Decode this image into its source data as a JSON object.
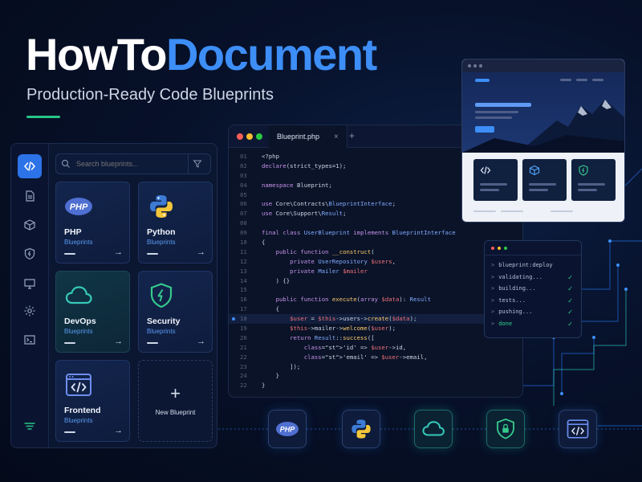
{
  "brand": {
    "word_white": "HowTo",
    "word_blue": "Document",
    "tagline": "Production-Ready Code Blueprints"
  },
  "colors": {
    "accent": "#3d8ef7",
    "green": "#27c488",
    "teal": "#2fc2b0",
    "background": "#07112a"
  },
  "sidebar": {
    "rail_icons": [
      "code-icon",
      "document-icon",
      "cube-icon",
      "shield-bolt-icon",
      "monitor-icon",
      "gear-icon",
      "terminal-icon",
      "filter-lines-icon"
    ],
    "search": {
      "placeholder": "Search blueprints..."
    },
    "cards": [
      {
        "name": "PHP",
        "subtitle": "Blueprints",
        "icon": "php-logo-icon"
      },
      {
        "name": "Python",
        "subtitle": "Blueprints",
        "icon": "python-logo-icon"
      },
      {
        "name": "DevOps",
        "subtitle": "Blueprints",
        "icon": "cloud-icon"
      },
      {
        "name": "Security",
        "subtitle": "Blueprints",
        "icon": "shield-bolt-icon"
      },
      {
        "name": "Frontend",
        "subtitle": "Blueprints",
        "icon": "browser-code-icon"
      }
    ],
    "new_card": {
      "label": "New Blueprint",
      "plus": "+"
    }
  },
  "editor": {
    "tab": "Blueprint.php",
    "tab_close": "×",
    "add_tab": "+",
    "active_line": "18",
    "lines": [
      {
        "n": "01",
        "code": "<?php"
      },
      {
        "n": "02",
        "code": "declare(strict_types=1);"
      },
      {
        "n": "03",
        "code": ""
      },
      {
        "n": "04",
        "code": "namespace Blueprint;"
      },
      {
        "n": "05",
        "code": ""
      },
      {
        "n": "06",
        "code": "use Core\\Contracts\\BlueprintInterface;"
      },
      {
        "n": "07",
        "code": "use Core\\Support\\Result;"
      },
      {
        "n": "08",
        "code": ""
      },
      {
        "n": "09",
        "code": "final class UserBlueprint implements BlueprintInterface"
      },
      {
        "n": "10",
        "code": "{"
      },
      {
        "n": "11",
        "code": "    public function __construct("
      },
      {
        "n": "12",
        "code": "        private UserRepository $users,"
      },
      {
        "n": "13",
        "code": "        private Mailer $mailer"
      },
      {
        "n": "14",
        "code": "    ) {}"
      },
      {
        "n": "15",
        "code": ""
      },
      {
        "n": "16",
        "code": "    public function execute(array $data): Result"
      },
      {
        "n": "17",
        "code": "    {"
      },
      {
        "n": "18",
        "code": "        $user = $this->users->create($data);"
      },
      {
        "n": "19",
        "code": "        $this->mailer->welcome($user);"
      },
      {
        "n": "20",
        "code": "        return Result::success(["
      },
      {
        "n": "21",
        "code": "            'id' => $user->id,"
      },
      {
        "n": "22",
        "code": "            'email' => $user->email,"
      },
      {
        "n": "23",
        "code": "        ]);"
      },
      {
        "n": "24",
        "code": "    }"
      },
      {
        "n": "22",
        "code": "}"
      }
    ]
  },
  "terminal": {
    "prompt": ">",
    "check": "✓",
    "lines": [
      {
        "text": "blueprint:deploy",
        "checked": false
      },
      {
        "text": "validating...",
        "checked": true
      },
      {
        "text": "building...",
        "checked": true
      },
      {
        "text": "tests...",
        "checked": true
      },
      {
        "text": "pushing...",
        "checked": true
      },
      {
        "text": "done",
        "checked": true
      }
    ]
  },
  "pipeline": {
    "steps": [
      {
        "icon": "php-logo-icon",
        "label": "PHP"
      },
      {
        "icon": "python-logo-icon"
      },
      {
        "icon": "cloud-icon"
      },
      {
        "icon": "shield-lock-icon"
      },
      {
        "icon": "browser-code-icon"
      }
    ]
  }
}
